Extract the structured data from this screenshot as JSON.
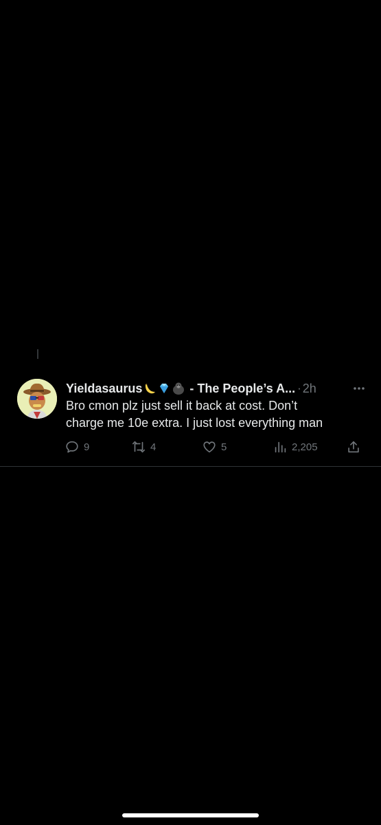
{
  "tweet": {
    "display_name": "Yieldasaurus",
    "emojis": [
      "banana-icon",
      "gem-icon",
      "gorilla-icon"
    ],
    "name_suffix": "- The People’s A...",
    "separator": "·",
    "time": "2h",
    "body_lines": [
      "Bro cmon plz just sell it back at cost. Don’t",
      "charge me 10e extra. I just lost everything man"
    ],
    "actions": {
      "replies": "9",
      "retweets": "4",
      "likes": "5",
      "views": "2,205"
    }
  },
  "colors": {
    "background": "#000000",
    "text": "#e7e9ea",
    "muted": "#71767b",
    "divider": "#2f3336"
  }
}
